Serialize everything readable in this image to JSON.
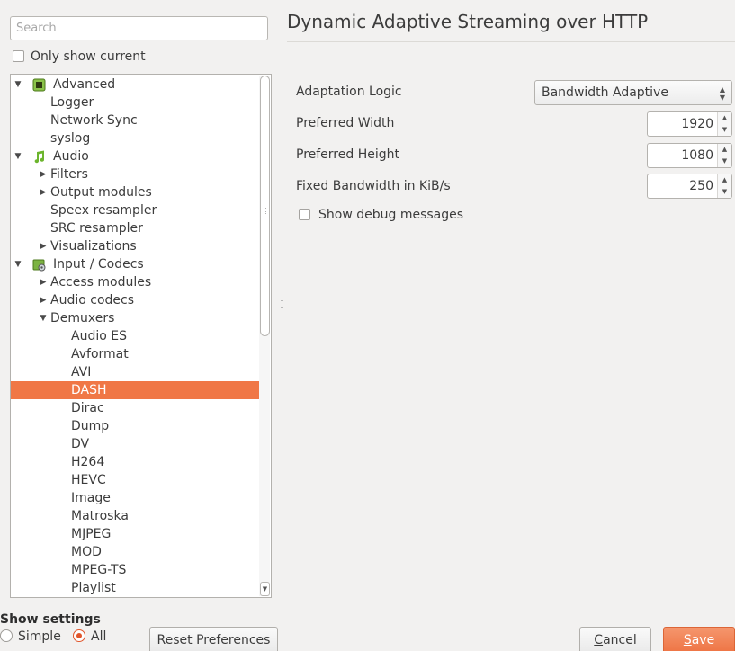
{
  "search": {
    "placeholder": "Search"
  },
  "only_current": {
    "label": "Only show current",
    "checked": false
  },
  "tree": {
    "rows": [
      {
        "label": "Advanced",
        "level": 0,
        "arrow": "expanded",
        "icon": "chip-icon"
      },
      {
        "label": "Logger",
        "level": 1
      },
      {
        "label": "Network Sync",
        "level": 1
      },
      {
        "label": "syslog",
        "level": 1
      },
      {
        "label": "Audio",
        "level": 0,
        "arrow": "expanded",
        "icon": "music-note-icon"
      },
      {
        "label": "Filters",
        "level": 1,
        "arrow": "collapsed"
      },
      {
        "label": "Output modules",
        "level": 1,
        "arrow": "collapsed"
      },
      {
        "label": "Speex resampler",
        "level": 1
      },
      {
        "label": "SRC resampler",
        "level": 1
      },
      {
        "label": "Visualizations",
        "level": 1,
        "arrow": "collapsed"
      },
      {
        "label": "Input / Codecs",
        "level": 0,
        "arrow": "expanded",
        "icon": "codec-icon"
      },
      {
        "label": "Access modules",
        "level": 1,
        "arrow": "collapsed"
      },
      {
        "label": "Audio codecs",
        "level": 1,
        "arrow": "collapsed"
      },
      {
        "label": "Demuxers",
        "level": 1,
        "arrow": "expanded"
      },
      {
        "label": "Audio ES",
        "level": 2
      },
      {
        "label": "Avformat",
        "level": 2
      },
      {
        "label": "AVI",
        "level": 2
      },
      {
        "label": "DASH",
        "level": 2,
        "selected": true
      },
      {
        "label": "Dirac",
        "level": 2
      },
      {
        "label": "Dump",
        "level": 2
      },
      {
        "label": "DV",
        "level": 2
      },
      {
        "label": "H264",
        "level": 2
      },
      {
        "label": "HEVC",
        "level": 2
      },
      {
        "label": "Image",
        "level": 2
      },
      {
        "label": "Matroska",
        "level": 2
      },
      {
        "label": "MJPEG",
        "level": 2
      },
      {
        "label": "MOD",
        "level": 2
      },
      {
        "label": "MPEG-TS",
        "level": 2
      },
      {
        "label": "Playlist",
        "level": 2
      }
    ]
  },
  "panel": {
    "title": "Dynamic Adaptive Streaming over HTTP",
    "adaptation_logic": {
      "label": "Adaptation Logic",
      "value": "Bandwidth Adaptive"
    },
    "preferred_width": {
      "label": "Preferred Width",
      "value": "1920"
    },
    "preferred_height": {
      "label": "Preferred Height",
      "value": "1080"
    },
    "fixed_bandwidth": {
      "label": "Fixed Bandwidth in KiB/s",
      "value": "250"
    },
    "show_debug": {
      "label": "Show debug messages",
      "checked": false
    }
  },
  "bottom": {
    "show_settings_label": "Show settings",
    "simple_label": "Simple",
    "all_label": "All",
    "selected_mode": "All",
    "reset_label": "Reset Preferences",
    "cancel_label": "Cancel",
    "save_label": "Save"
  },
  "colors": {
    "selection": "#f07746",
    "accent": "#e0552b",
    "save_button": "#ee7444"
  }
}
